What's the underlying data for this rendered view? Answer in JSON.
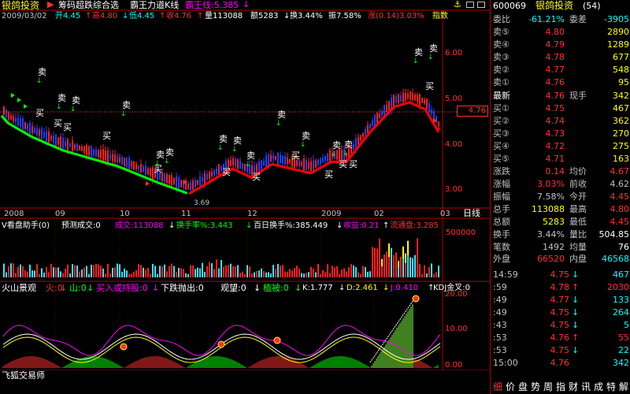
{
  "app": {
    "stock_name": "银鸽投资",
    "bottom_title": "飞狐交易师"
  },
  "tool_tabs": {
    "label1": "筹码超跌综合选",
    "label2": "霸王力道K线",
    "label3": "霸王线:5.385"
  },
  "price_info": {
    "date": "2009/03/02",
    "open": "开4.45",
    "high": "高4.80",
    "low": "低4.45",
    "close": "收4.76",
    "volume": "量113088",
    "amount": "额5283",
    "turnover": "换3.44%",
    "amplitude": "振7.58%",
    "change": "涨(0.14)3.03%",
    "index_tab": "指数"
  },
  "y_axis_main": [
    "6.00",
    "5.00",
    "4.00",
    "3.00"
  ],
  "current_price_tag": "4.76",
  "x_axis": [
    "2008",
    "09",
    "10",
    "11",
    "12",
    "2009",
    "02",
    "03"
  ],
  "period_tab": "日线",
  "main_chart_labels": [
    "卖",
    "卖",
    "卖",
    "卖",
    "卖",
    "卖",
    "卖",
    "卖",
    "卖",
    "卖",
    "卖",
    "卖",
    "卖",
    "卖",
    "卖",
    "卖",
    "买",
    "买",
    "买",
    "买",
    "买",
    "买",
    "买",
    "买",
    "买",
    "买",
    "买",
    "买"
  ],
  "low_price_note": "3.69",
  "volume_panel": {
    "title": "V看盘助手(0)",
    "forecast": "预测成交:0",
    "volume": "成交:113088",
    "turnover_rate": "换手率%:3.443",
    "hundred_day": "百日换手%:385.449",
    "profit": "收益:0.21",
    "float_shares": "流通盘:3.285",
    "y_label": "500000"
  },
  "indicator_panel": {
    "title": "火山景观",
    "fire": "火:0",
    "mountain": "山:0",
    "buy_hold": "买入或持股:0",
    "fall": "下跌抛出:0",
    "watch": "观望:0",
    "plant": "植被:0",
    "k": "K:1.777",
    "d": "D:2.461",
    "j": "J:0.410",
    "kdj": "KDJ金叉:0",
    "y_labels": [
      "20.00",
      "10.00",
      "0.00"
    ]
  },
  "quote": {
    "code": "600069",
    "name": "银鸽投资",
    "period": "(54)",
    "ratio_label": "委比",
    "ratio_value": "-61.21%",
    "diff_label": "委差",
    "diff_value": "-3905",
    "sells": [
      {
        "label": "卖⑤",
        "price": "4.80",
        "vol": "2890"
      },
      {
        "label": "卖④",
        "price": "4.79",
        "vol": "1289"
      },
      {
        "label": "卖③",
        "price": "4.78",
        "vol": "677"
      },
      {
        "label": "卖②",
        "price": "4.77",
        "vol": "548"
      },
      {
        "label": "卖①",
        "price": "4.76",
        "vol": "95"
      }
    ],
    "last_label": "最新",
    "last_price": "4.76",
    "now_label": "现手",
    "now_value": "342",
    "buys": [
      {
        "label": "买①",
        "price": "4.75",
        "vol": "467"
      },
      {
        "label": "买②",
        "price": "4.74",
        "vol": "362"
      },
      {
        "label": "买③",
        "price": "4.73",
        "vol": "270"
      },
      {
        "label": "买④",
        "price": "4.72",
        "vol": "275"
      },
      {
        "label": "买⑤",
        "price": "4.71",
        "vol": "163"
      }
    ],
    "stats": [
      {
        "l1": "涨跌",
        "v1": "0.14",
        "l2": "均价",
        "v2": "4.67"
      },
      {
        "l1": "涨幅",
        "v1": "3.03%",
        "l2": "前收",
        "v2": "4.62"
      },
      {
        "l1": "振幅",
        "v1": "7.58%",
        "l2": "今开",
        "v2": "4.45"
      },
      {
        "l1": "总手",
        "v1": "113088",
        "l2": "最高",
        "v2": "4.80"
      },
      {
        "l1": "总额",
        "v1": "5283",
        "l2": "最低",
        "v2": "4.45"
      },
      {
        "l1": "换手",
        "v1": "3.44%",
        "l2": "量比",
        "v2": "504.85"
      },
      {
        "l1": "笔数",
        "v1": "1492",
        "l2": "均量",
        "v2": "76"
      }
    ],
    "outer_label": "外盘",
    "outer_value": "66520",
    "inner_label": "内盘",
    "inner_value": "46568"
  },
  "ticks": [
    {
      "time": "14:59",
      "price": "4.75",
      "arrow": "↓",
      "vol": "467"
    },
    {
      "time": ":59",
      "price": "4.78",
      "arrow": "↑",
      "vol": "2030"
    },
    {
      "time": ":49",
      "price": "4.77",
      "arrow": "↓",
      "vol": "133"
    },
    {
      "time": ":49",
      "price": "4.75",
      "arrow": "↓",
      "vol": "264"
    },
    {
      "time": ":43",
      "price": "4.75",
      "arrow": "↓",
      "vol": "5"
    },
    {
      "time": ":53",
      "price": "4.76",
      "arrow": "↑",
      "vol": "55"
    },
    {
      "time": ":53",
      "price": "4.75",
      "arrow": "↓",
      "vol": "22"
    },
    {
      "time": "15:00",
      "price": "4.76",
      "arrow": "",
      "vol": "342"
    }
  ],
  "bottom_tabs": [
    "细",
    "价",
    "盘",
    "势",
    "周",
    "指",
    "财",
    "讯",
    "成",
    "特",
    "解"
  ],
  "colors": {
    "up": "#ff3030",
    "down": "#00ffff",
    "green": "#00ff00",
    "yellow": "#ffff00",
    "magenta": "#ff00ff",
    "white": "#ffffff"
  }
}
